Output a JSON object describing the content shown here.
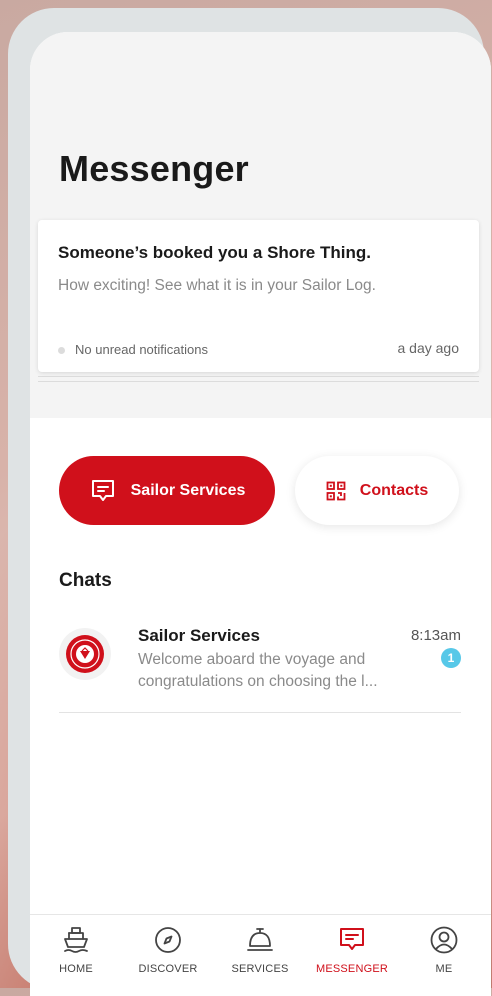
{
  "page": {
    "title": "Messenger"
  },
  "notification": {
    "title": "Someone’s booked you a Shore Thing.",
    "body": "How exciting! See what it is in your Sailor Log.",
    "status": "No unread notifications",
    "time": "a day ago"
  },
  "actions": {
    "sailor_services": "Sailor Services",
    "contacts": "Contacts"
  },
  "chats": {
    "heading": "Chats",
    "items": [
      {
        "name": "Sailor Services",
        "time": "8:13am",
        "preview": "Welcome aboard the voyage and congratulations on choosing the l...",
        "unread": "1",
        "avatar_text": "SAILOR SERVICES"
      }
    ]
  },
  "tabs": [
    {
      "label": "HOME",
      "icon": "ship-icon"
    },
    {
      "label": "DISCOVER",
      "icon": "compass-icon"
    },
    {
      "label": "SERVICES",
      "icon": "service-bell-icon"
    },
    {
      "label": "MESSENGER",
      "icon": "message-icon"
    },
    {
      "label": "ME",
      "icon": "user-icon"
    }
  ],
  "colors": {
    "accent": "#d0101b",
    "badge": "#57c8e8"
  }
}
